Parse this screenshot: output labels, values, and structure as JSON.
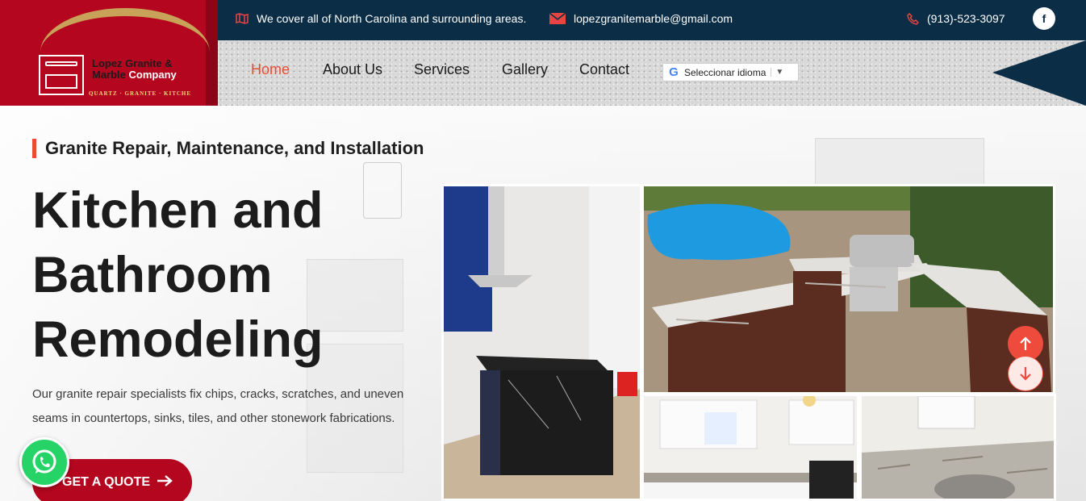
{
  "logo": {
    "line1": "Lopez Granite &",
    "line2_a": "Marble",
    "line2_b": "Company",
    "tagline": "QUARTZ · GRANITE · KITCHE"
  },
  "topbar": {
    "coverage": "We cover all of North Carolina and surrounding areas.",
    "email": "lopezgranitemarble@gmail.com",
    "phone": "(913)-523-3097",
    "social": "f"
  },
  "nav": {
    "items": [
      {
        "label": "Home",
        "active": true
      },
      {
        "label": "About Us"
      },
      {
        "label": "Services"
      },
      {
        "label": "Gallery"
      },
      {
        "label": "Contact"
      }
    ],
    "translate_label": "Seleccionar idioma"
  },
  "hero": {
    "subtitle": "Granite Repair, Maintenance, and Installation",
    "headline_l1": "Kitchen and",
    "headline_l2": "Bathroom",
    "headline_l3": "Remodeling",
    "description": "Our granite repair specialists fix chips, cracks, scratches, and uneven seams in countertops, sinks, tiles, and other stonework fabrications.",
    "cta": "GET A QUOTE"
  },
  "colors": {
    "brand_red": "#b5061f",
    "navy": "#0b2d45",
    "accent": "#e94b35",
    "whatsapp": "#25d366"
  }
}
